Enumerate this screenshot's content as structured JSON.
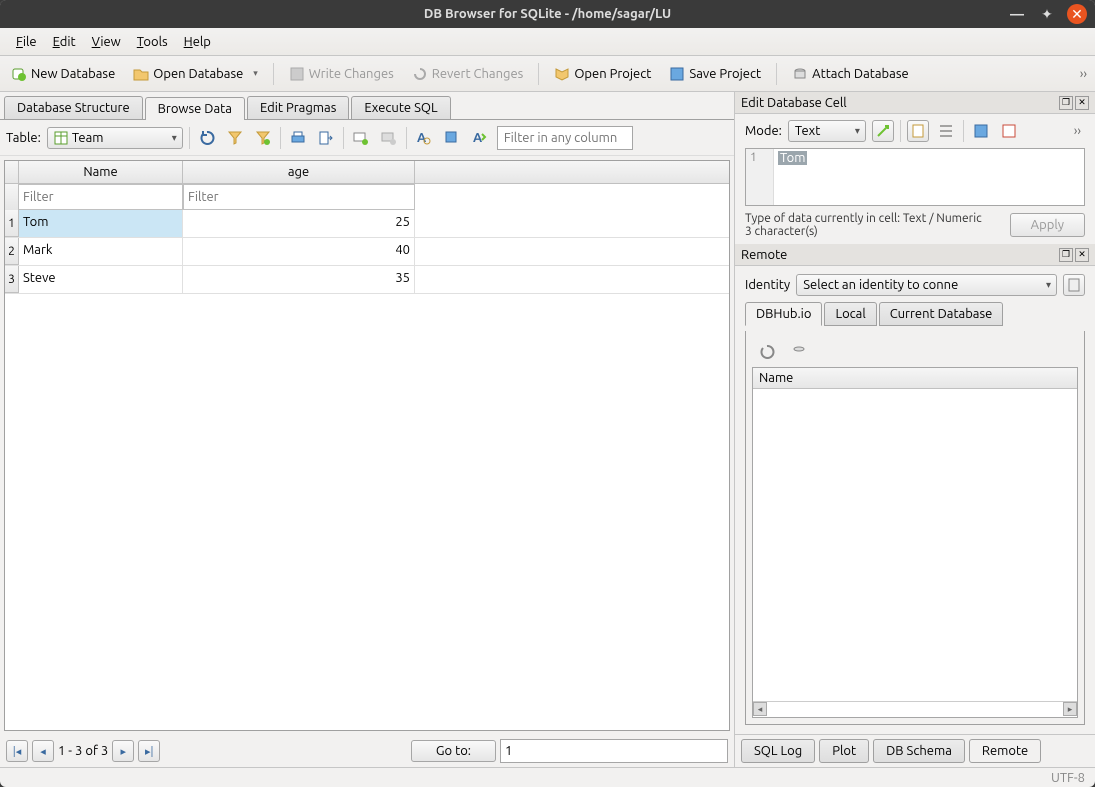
{
  "title": "DB Browser for SQLite - /home/sagar/LU",
  "menus": {
    "file": "File",
    "edit": "Edit",
    "view": "View",
    "tools": "Tools",
    "help": "Help"
  },
  "toolbar": {
    "new_db": "New Database",
    "open_db": "Open Database",
    "write_changes": "Write Changes",
    "revert_changes": "Revert Changes",
    "open_project": "Open Project",
    "save_project": "Save Project",
    "attach_db": "Attach Database",
    "more": "››"
  },
  "tabs": {
    "structure": "Database Structure",
    "browse": "Browse Data",
    "pragmas": "Edit Pragmas",
    "sql": "Execute SQL"
  },
  "browse": {
    "table_label": "Table:",
    "table_value": "Team",
    "any_filter_ph": "Filter in any column",
    "col_filter_ph": "Filter",
    "columns": [
      "Name",
      "age"
    ],
    "rows": [
      {
        "n": "1",
        "name": "Tom",
        "age": "25"
      },
      {
        "n": "2",
        "name": "Mark",
        "age": "40"
      },
      {
        "n": "3",
        "name": "Steve",
        "age": "35"
      }
    ],
    "page_info": "1 - 3 of 3",
    "go_to": "Go to:",
    "go_to_value": "1"
  },
  "editcell": {
    "title": "Edit Database Cell",
    "mode_label": "Mode:",
    "mode_value": "Text",
    "line_no": "1",
    "cell_text": "Tom",
    "type_info": "Type of data currently in cell: Text / Numeric",
    "char_count": "3 character(s)",
    "apply": "Apply",
    "more": "››"
  },
  "remote": {
    "title": "Remote",
    "identity_label": "Identity",
    "identity_value": "Select an identity to conne",
    "tabs": {
      "dbhub": "DBHub.io",
      "local": "Local",
      "current": "Current Database"
    },
    "col_name": "Name"
  },
  "bottom_tabs": {
    "sqllog": "SQL Log",
    "plot": "Plot",
    "schema": "DB Schema",
    "remote": "Remote"
  },
  "status": "UTF-8"
}
